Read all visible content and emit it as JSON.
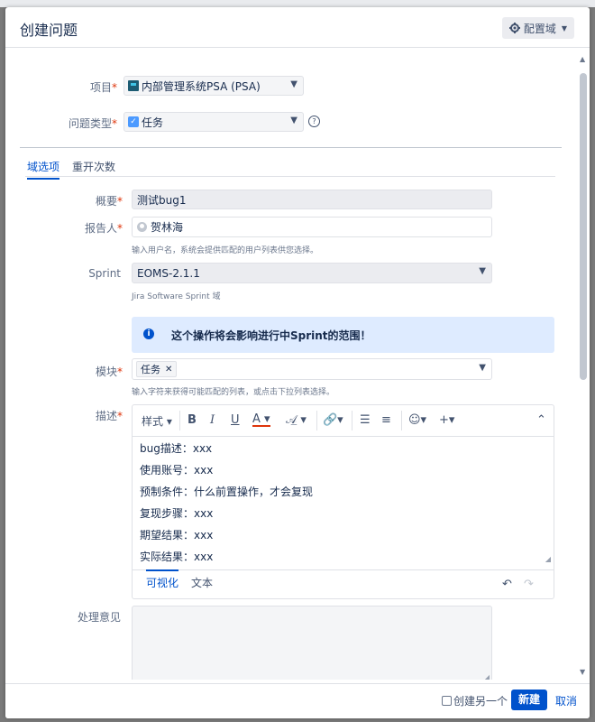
{
  "dialog": {
    "title": "创建问题",
    "configure_label": "配置域"
  },
  "fields": {
    "project": {
      "label": "项目",
      "value": "内部管理系统PSA (PSA)"
    },
    "issue_type": {
      "label": "问题类型",
      "value": "任务"
    },
    "summary": {
      "label": "概要",
      "value": "测试bug1"
    },
    "reporter": {
      "label": "报告人",
      "value": "贺林海",
      "hint": "输入用户名，系统会提供匹配的用户列表供您选择。"
    },
    "sprint": {
      "label": "Sprint",
      "value": "EOMS-2.1.1",
      "hint": "Jira Software Sprint 域"
    },
    "sprint_notice": "这个操作将会影响进行中Sprint的范围！",
    "component": {
      "label": "模块",
      "tag": "任务",
      "hint": "输入字符来获得可能匹配的列表，或点击下拉列表选择。"
    },
    "description": {
      "label": "描述",
      "toolbar": {
        "style_label": "样式",
        "bold": "B",
        "italic": "I",
        "underline": "U",
        "text_color": "A"
      },
      "lines": [
        "bug描述：xxx",
        "使用账号：xxx",
        "预制条件：什么前置操作，才会复现",
        "复现步骤：xxx",
        "期望结果：xxx",
        "实际结果：xxx"
      ],
      "modes": [
        "可视化",
        "文本"
      ]
    },
    "handling": {
      "label": "处理意见"
    }
  },
  "tabs": [
    "域选项",
    "重开次数"
  ],
  "footer": {
    "create_another": "创建另一个",
    "create_button": "新建",
    "cancel_link": "取消"
  }
}
